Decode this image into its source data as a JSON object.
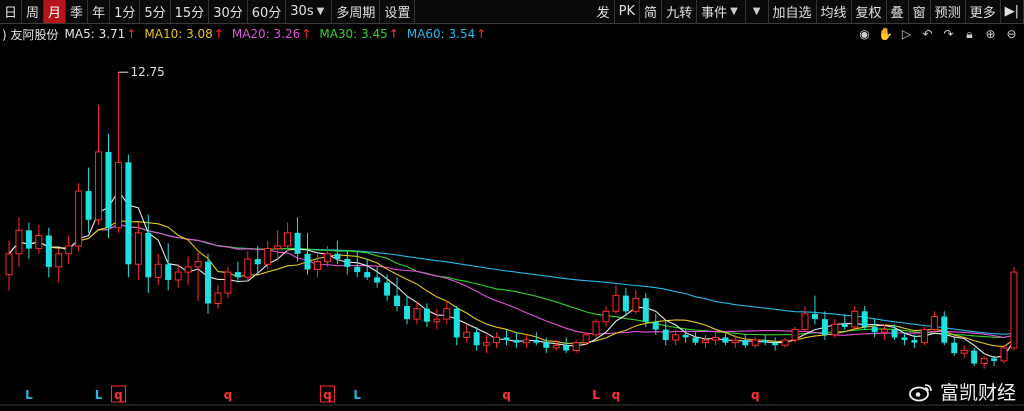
{
  "toolbar": {
    "left": [
      {
        "label": "日",
        "active": false
      },
      {
        "label": "周",
        "active": false
      },
      {
        "label": "月",
        "active": true
      },
      {
        "label": "季",
        "active": false
      },
      {
        "label": "年",
        "active": false
      },
      {
        "label": "1分",
        "active": false
      },
      {
        "label": "5分",
        "active": false
      },
      {
        "label": "15分",
        "active": false
      },
      {
        "label": "30分",
        "active": false
      },
      {
        "label": "60分",
        "active": false
      },
      {
        "label": "30s",
        "active": false,
        "dropdown": true
      },
      {
        "label": "多周期",
        "active": false
      },
      {
        "label": "设置",
        "active": false
      }
    ],
    "right": [
      {
        "label": "发"
      },
      {
        "label": "PK"
      },
      {
        "label": "简"
      },
      {
        "label": "九转"
      },
      {
        "label": "事件",
        "dropdown": true
      },
      {
        "label": "",
        "dropdown": true
      },
      {
        "label": "加自选"
      },
      {
        "label": "均线"
      },
      {
        "label": "复权"
      },
      {
        "label": "叠"
      },
      {
        "label": "窗"
      },
      {
        "label": "预测"
      },
      {
        "label": "更多"
      },
      {
        "label": "▶|"
      }
    ]
  },
  "info": {
    "prefix": ")",
    "stock_name": "友阿股份",
    "ma": [
      {
        "label": "MA5: 3.71",
        "color": "#e8e8e8"
      },
      {
        "label": "MA10: 3.08",
        "color": "#e6c619"
      },
      {
        "label": "MA20: 3.26",
        "color": "#e052d8"
      },
      {
        "label": "MA30: 3.45",
        "color": "#2fd12f"
      },
      {
        "label": "MA60: 3.54",
        "color": "#27b7e6"
      }
    ],
    "arrow": "↑",
    "icons": [
      "eye-icon",
      "hand-icon",
      "play-icon",
      "undo-icon",
      "redo-icon",
      "lock-icon",
      "zoom-in-icon",
      "zoom-out-icon"
    ]
  },
  "chart_data": {
    "type": "candlestick",
    "price_range": [
      1.2,
      13.6
    ],
    "max_label": "12.75",
    "max_value": 12.75,
    "up_color": "#ff2a2a",
    "down_color": "#1fe0e0",
    "ohlc": [
      [
        5.0,
        6.3,
        4.4,
        5.8
      ],
      [
        5.8,
        7.2,
        5.3,
        6.7
      ],
      [
        6.7,
        7.0,
        5.6,
        6.0
      ],
      [
        6.0,
        6.9,
        5.8,
        6.5
      ],
      [
        6.5,
        6.8,
        4.9,
        5.3
      ],
      [
        5.3,
        6.0,
        4.7,
        5.8
      ],
      [
        5.8,
        6.5,
        5.4,
        6.1
      ],
      [
        6.1,
        8.5,
        5.9,
        8.2
      ],
      [
        8.2,
        9.1,
        6.6,
        7.1
      ],
      [
        7.1,
        11.5,
        6.9,
        9.7
      ],
      [
        9.7,
        10.4,
        6.4,
        6.8
      ],
      [
        6.8,
        12.75,
        6.6,
        9.3
      ],
      [
        9.3,
        9.6,
        4.9,
        5.4
      ],
      [
        5.4,
        7.0,
        4.8,
        6.6
      ],
      [
        6.6,
        7.3,
        4.3,
        4.9
      ],
      [
        4.9,
        5.8,
        4.6,
        5.4
      ],
      [
        5.4,
        6.2,
        4.4,
        4.8
      ],
      [
        4.8,
        5.4,
        4.5,
        5.1
      ],
      [
        5.1,
        5.7,
        4.6,
        5.3
      ],
      [
        5.3,
        5.9,
        4.0,
        5.5
      ],
      [
        5.5,
        5.8,
        3.5,
        3.9
      ],
      [
        3.9,
        4.6,
        3.7,
        4.3
      ],
      [
        4.3,
        5.3,
        4.1,
        5.1
      ],
      [
        5.1,
        5.5,
        4.7,
        4.9
      ],
      [
        4.9,
        5.9,
        4.8,
        5.6
      ],
      [
        5.6,
        6.1,
        5.0,
        5.4
      ],
      [
        5.4,
        6.3,
        5.2,
        6.0
      ],
      [
        6.0,
        6.7,
        5.6,
        6.1
      ],
      [
        6.1,
        7.0,
        5.9,
        6.6
      ],
      [
        6.6,
        7.2,
        5.5,
        5.8
      ],
      [
        5.8,
        6.6,
        5.0,
        5.2
      ],
      [
        5.2,
        5.8,
        4.9,
        5.5
      ],
      [
        5.5,
        6.1,
        5.3,
        5.8
      ],
      [
        5.8,
        6.3,
        5.4,
        5.6
      ],
      [
        5.6,
        5.9,
        5.0,
        5.3
      ],
      [
        5.3,
        5.9,
        4.9,
        5.1
      ],
      [
        5.1,
        5.6,
        4.8,
        4.9
      ],
      [
        4.9,
        5.3,
        4.5,
        4.7
      ],
      [
        4.7,
        5.0,
        4.0,
        4.2
      ],
      [
        4.2,
        4.9,
        3.6,
        3.8
      ],
      [
        3.8,
        4.2,
        3.1,
        3.3
      ],
      [
        3.3,
        4.0,
        3.1,
        3.7
      ],
      [
        3.7,
        3.9,
        3.0,
        3.2
      ],
      [
        3.2,
        3.7,
        2.9,
        3.3
      ],
      [
        3.3,
        4.0,
        3.1,
        3.7
      ],
      [
        3.7,
        3.8,
        2.3,
        2.6
      ],
      [
        2.6,
        3.1,
        2.4,
        2.8
      ],
      [
        2.8,
        3.0,
        2.1,
        2.3
      ],
      [
        2.3,
        2.7,
        2.0,
        2.4
      ],
      [
        2.4,
        2.8,
        2.2,
        2.6
      ],
      [
        2.6,
        2.9,
        2.3,
        2.5
      ],
      [
        2.5,
        2.8,
        2.2,
        2.4
      ],
      [
        2.4,
        2.7,
        2.2,
        2.5
      ],
      [
        2.5,
        2.8,
        2.3,
        2.4
      ],
      [
        2.4,
        2.6,
        2.0,
        2.2
      ],
      [
        2.2,
        2.5,
        2.1,
        2.3
      ],
      [
        2.3,
        2.6,
        2.0,
        2.1
      ],
      [
        2.1,
        2.5,
        2.0,
        2.4
      ],
      [
        2.4,
        2.8,
        2.3,
        2.7
      ],
      [
        2.7,
        3.3,
        2.6,
        3.2
      ],
      [
        3.2,
        3.8,
        3.0,
        3.6
      ],
      [
        3.6,
        4.6,
        3.5,
        4.2
      ],
      [
        4.2,
        4.5,
        3.4,
        3.6
      ],
      [
        3.6,
        4.4,
        3.5,
        4.1
      ],
      [
        4.1,
        4.3,
        3.0,
        3.2
      ],
      [
        3.2,
        3.5,
        2.7,
        2.9
      ],
      [
        2.9,
        3.2,
        2.3,
        2.5
      ],
      [
        2.5,
        2.9,
        2.3,
        2.7
      ],
      [
        2.7,
        2.9,
        2.4,
        2.6
      ],
      [
        2.6,
        2.8,
        2.3,
        2.4
      ],
      [
        2.4,
        2.7,
        2.2,
        2.5
      ],
      [
        2.5,
        2.8,
        2.3,
        2.6
      ],
      [
        2.6,
        2.8,
        2.3,
        2.4
      ],
      [
        2.4,
        2.7,
        2.2,
        2.5
      ],
      [
        2.5,
        2.7,
        2.2,
        2.3
      ],
      [
        2.3,
        2.6,
        2.2,
        2.5
      ],
      [
        2.5,
        2.7,
        2.3,
        2.4
      ],
      [
        2.4,
        2.6,
        2.1,
        2.3
      ],
      [
        2.3,
        2.6,
        2.2,
        2.5
      ],
      [
        2.5,
        3.0,
        2.4,
        2.9
      ],
      [
        2.9,
        3.8,
        2.8,
        3.5
      ],
      [
        3.5,
        4.2,
        3.1,
        3.3
      ],
      [
        3.3,
        3.6,
        2.5,
        2.7
      ],
      [
        2.7,
        3.3,
        2.6,
        3.1
      ],
      [
        3.1,
        3.5,
        2.9,
        3.0
      ],
      [
        3.0,
        3.8,
        2.9,
        3.6
      ],
      [
        3.6,
        3.8,
        2.9,
        3.0
      ],
      [
        3.0,
        3.3,
        2.6,
        2.8
      ],
      [
        2.8,
        3.1,
        2.5,
        2.9
      ],
      [
        2.9,
        3.1,
        2.5,
        2.6
      ],
      [
        2.6,
        2.8,
        2.3,
        2.5
      ],
      [
        2.5,
        2.7,
        2.2,
        2.4
      ],
      [
        2.4,
        3.0,
        2.3,
        2.9
      ],
      [
        2.9,
        3.6,
        2.8,
        3.4
      ],
      [
        3.4,
        3.6,
        2.3,
        2.4
      ],
      [
        2.4,
        2.6,
        1.9,
        2.0
      ],
      [
        2.0,
        2.3,
        1.8,
        2.1
      ],
      [
        2.1,
        2.2,
        1.5,
        1.6
      ],
      [
        1.6,
        1.9,
        1.4,
        1.8
      ],
      [
        1.8,
        1.9,
        1.5,
        1.7
      ],
      [
        1.7,
        2.3,
        1.6,
        2.2
      ],
      [
        2.2,
        5.3,
        2.1,
        5.1
      ]
    ],
    "markers": [
      {
        "index": 2,
        "label": "L",
        "color": "#27b7e6",
        "boxed": false
      },
      {
        "index": 9,
        "label": "L",
        "color": "#27b7e6",
        "boxed": false
      },
      {
        "index": 11,
        "label": "q",
        "color": "#ff3030",
        "boxed": true
      },
      {
        "index": 22,
        "label": "q",
        "color": "#ff3030",
        "boxed": false
      },
      {
        "index": 32,
        "label": "q",
        "color": "#ff3030",
        "boxed": true
      },
      {
        "index": 35,
        "label": "L",
        "color": "#27b7e6",
        "boxed": false
      },
      {
        "index": 50,
        "label": "q",
        "color": "#ff3030",
        "boxed": false
      },
      {
        "index": 59,
        "label": "L",
        "color": "#ff3030",
        "boxed": false
      },
      {
        "index": 61,
        "label": "q",
        "color": "#ff3030",
        "boxed": false
      },
      {
        "index": 75,
        "label": "q",
        "color": "#ff3030",
        "boxed": false
      }
    ]
  },
  "watermark": {
    "text": "富凯财经"
  }
}
